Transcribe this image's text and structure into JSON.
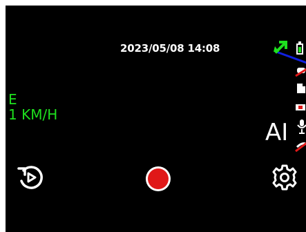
{
  "overlay": {
    "datetime": "2023/05/08 14:08",
    "direction": "E",
    "speed": "1 KM/H",
    "ai_label": "AI"
  },
  "colors": {
    "background": "#000000",
    "accent_green": "#1ee01e",
    "record_red": "#e01818",
    "status_blue": "#1020e0"
  },
  "controls": {
    "replay_icon": "replay-icon",
    "record_icon": "record-icon",
    "settings_icon": "gear-icon"
  },
  "status_icons": [
    "gps-signal-icon",
    "battery-icon",
    "mic-off-icon",
    "file-icon",
    "sd-card-icon",
    "microphone-icon",
    "wifi-off-icon"
  ]
}
